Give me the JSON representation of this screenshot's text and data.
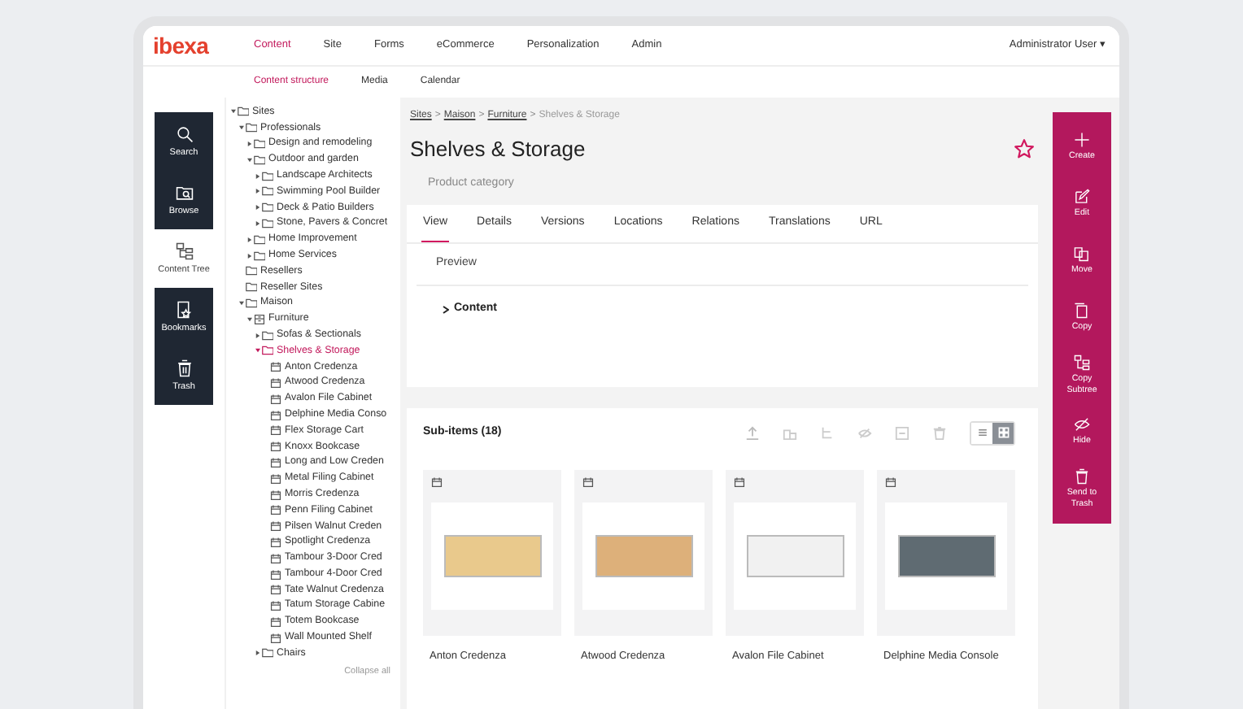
{
  "logo": "ibexa",
  "main_nav": [
    {
      "label": "Content",
      "selected": true
    },
    {
      "label": "Site",
      "selected": false
    },
    {
      "label": "Forms",
      "selected": false
    },
    {
      "label": "eCommerce",
      "selected": false
    },
    {
      "label": "Personalization",
      "selected": false
    },
    {
      "label": "Admin",
      "selected": false
    }
  ],
  "user_menu": {
    "label": "Administrator User",
    "caret": "▾"
  },
  "sub_nav": [
    {
      "label": "Content structure",
      "selected": true
    },
    {
      "label": "Media",
      "selected": false
    },
    {
      "label": "Calendar",
      "selected": false
    }
  ],
  "left_rail": [
    {
      "label": "Search",
      "selected": false
    },
    {
      "label": "Browse",
      "selected": false
    },
    {
      "label": "Content Tree",
      "selected": true
    },
    {
      "label": "Bookmarks",
      "selected": false
    },
    {
      "label": "Trash",
      "selected": false
    }
  ],
  "tree": {
    "nodes": [
      {
        "label": "Sites",
        "kind": "folder",
        "expanded": true,
        "selected": false,
        "children": [
          {
            "label": "Professionals",
            "kind": "folder",
            "expanded": true,
            "selected": false,
            "children": [
              {
                "label": "Design and remodeling",
                "kind": "folder",
                "expanded": false,
                "selected": false
              },
              {
                "label": "Outdoor and garden",
                "kind": "folder",
                "expanded": true,
                "selected": false,
                "children": [
                  {
                    "label": "Landscape Architects",
                    "kind": "folder",
                    "expanded": false,
                    "selected": false
                  },
                  {
                    "label": "Swimming Pool Builder",
                    "kind": "folder",
                    "expanded": false,
                    "selected": false
                  },
                  {
                    "label": "Deck & Patio Builders",
                    "kind": "folder",
                    "expanded": false,
                    "selected": false
                  },
                  {
                    "label": "Stone, Pavers & Concret",
                    "kind": "folder",
                    "expanded": false,
                    "selected": false
                  }
                ]
              },
              {
                "label": "Home Improvement",
                "kind": "folder",
                "expanded": false,
                "selected": false
              },
              {
                "label": "Home Services",
                "kind": "folder",
                "expanded": false,
                "selected": false
              }
            ]
          },
          {
            "label": "Resellers",
            "kind": "folder",
            "selected": false
          },
          {
            "label": "Reseller Sites",
            "kind": "folder",
            "selected": false
          },
          {
            "label": "Maison",
            "kind": "folder",
            "expanded": true,
            "selected": false,
            "children": [
              {
                "label": "Furniture",
                "kind": "category",
                "expanded": true,
                "selected": false,
                "children": [
                  {
                    "label": "Sofas & Sectionals",
                    "kind": "folder",
                    "expanded": false,
                    "selected": false
                  },
                  {
                    "label": "Shelves & Storage",
                    "kind": "folder",
                    "expanded": true,
                    "selected": true,
                    "children": [
                      {
                        "label": "Anton Credenza",
                        "kind": "item",
                        "selected": false
                      },
                      {
                        "label": "Atwood Credenza",
                        "kind": "item",
                        "selected": false
                      },
                      {
                        "label": "Avalon File Cabinet",
                        "kind": "item",
                        "selected": false
                      },
                      {
                        "label": "Delphine Media Conso",
                        "kind": "item",
                        "selected": false
                      },
                      {
                        "label": "Flex Storage Cart",
                        "kind": "item",
                        "selected": false
                      },
                      {
                        "label": "Knoxx Bookcase",
                        "kind": "item",
                        "selected": false
                      },
                      {
                        "label": "Long and Low Creden",
                        "kind": "item",
                        "selected": false
                      },
                      {
                        "label": "Metal Filing Cabinet",
                        "kind": "item",
                        "selected": false
                      },
                      {
                        "label": "Morris Credenza",
                        "kind": "item",
                        "selected": false
                      },
                      {
                        "label": "Penn Filing Cabinet",
                        "kind": "item",
                        "selected": false
                      },
                      {
                        "label": "Pilsen Walnut Creden",
                        "kind": "item",
                        "selected": false
                      },
                      {
                        "label": "Spotlight Credenza",
                        "kind": "item",
                        "selected": false
                      },
                      {
                        "label": "Tambour 3-Door Cred",
                        "kind": "item",
                        "selected": false
                      },
                      {
                        "label": "Tambour 4-Door Cred",
                        "kind": "item",
                        "selected": false
                      },
                      {
                        "label": "Tate Walnut Credenza",
                        "kind": "item",
                        "selected": false
                      },
                      {
                        "label": "Tatum Storage Cabine",
                        "kind": "item",
                        "selected": false
                      },
                      {
                        "label": "Totem Bookcase",
                        "kind": "item",
                        "selected": false
                      },
                      {
                        "label": "Wall Mounted Shelf",
                        "kind": "item",
                        "selected": false
                      }
                    ]
                  },
                  {
                    "label": "Chairs",
                    "kind": "folder",
                    "expanded": false,
                    "selected": false
                  }
                ]
              }
            ]
          }
        ]
      }
    ],
    "collapse_all": "Collapse all"
  },
  "breadcrumb": {
    "separator": ">",
    "items": [
      {
        "label": "Sites",
        "link": true
      },
      {
        "label": "Maison",
        "link": true
      },
      {
        "label": "Furniture",
        "link": true
      },
      {
        "label": "Shelves & Storage",
        "link": false
      }
    ]
  },
  "title": "Shelves & Storage",
  "content_type": "Product category",
  "bookmarked": false,
  "tabs": [
    {
      "label": "View",
      "selected": true
    },
    {
      "label": "Details",
      "selected": false
    },
    {
      "label": "Versions",
      "selected": false
    },
    {
      "label": "Locations",
      "selected": false
    },
    {
      "label": "Relations",
      "selected": false
    },
    {
      "label": "Translations",
      "selected": false
    },
    {
      "label": "URL",
      "selected": false
    }
  ],
  "preview_label": "Preview",
  "content_section": {
    "label": "Content",
    "expanded": false
  },
  "sub_items": {
    "title": "Sub-items (18)",
    "view_modes": [
      {
        "selected": false
      },
      {
        "selected": true
      }
    ],
    "cards": [
      {
        "name": "Anton Credenza"
      },
      {
        "name": "Atwood Credenza"
      },
      {
        "name": "Avalon File Cabinet"
      },
      {
        "name": "Delphine Media Console"
      }
    ]
  },
  "right_rail": [
    {
      "label": "Create"
    },
    {
      "label": "Edit"
    },
    {
      "label": "Move"
    },
    {
      "label": "Copy"
    },
    {
      "label": "Copy Subtree"
    },
    {
      "label": "Hide"
    },
    {
      "label": "Send to Trash"
    }
  ]
}
